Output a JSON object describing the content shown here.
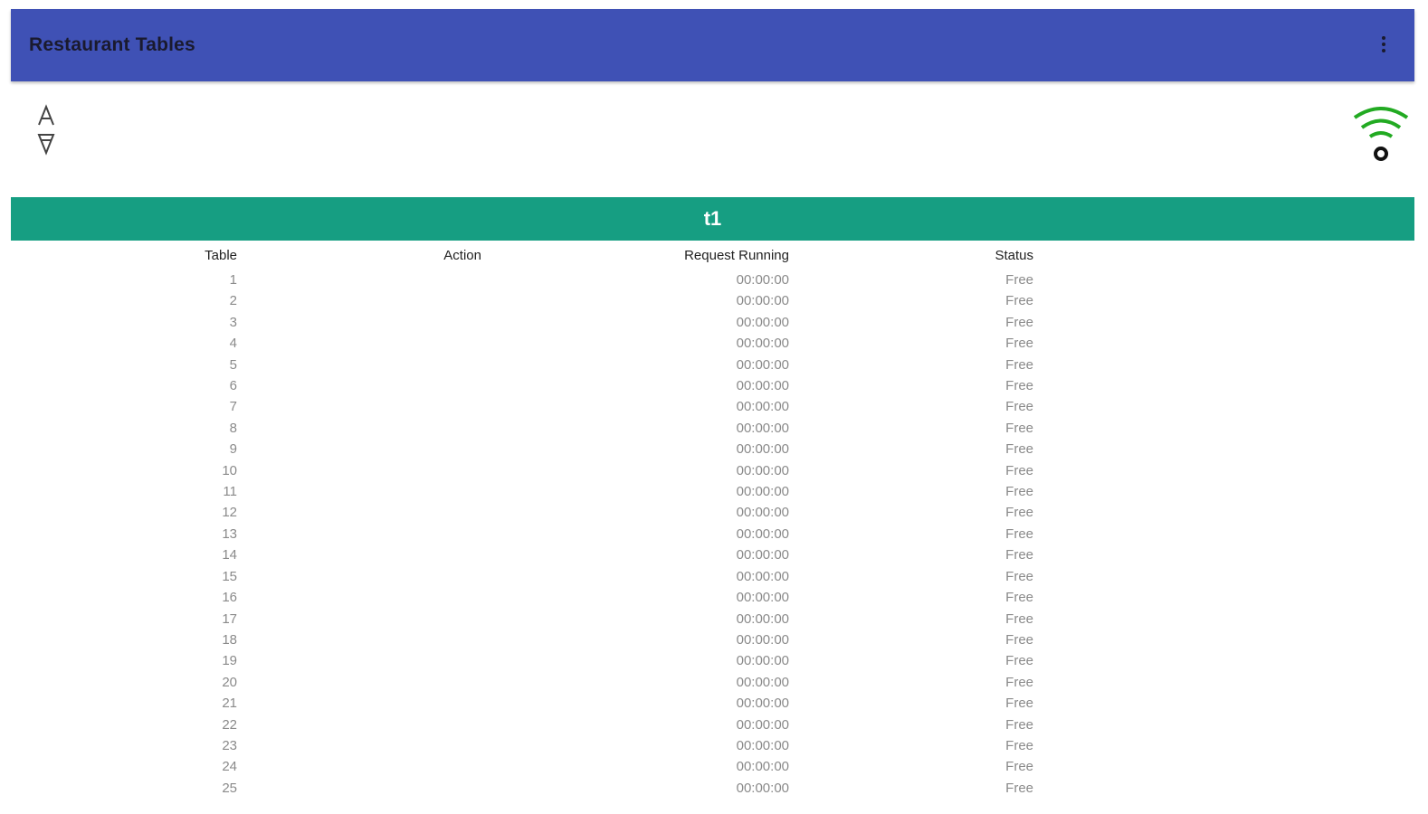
{
  "app_bar": {
    "title": "Restaurant Tables",
    "bg_color": "#3f51b5",
    "menu_icon": "more-vert-icon"
  },
  "toolbar": {
    "sort_icon": "sort-ascending-descending-icon",
    "connection_icon": "wifi-connected-icon",
    "connection_color": "#22aa22"
  },
  "section": {
    "title": "t1",
    "bg_color": "#169e82"
  },
  "table": {
    "headers": {
      "table": "Table",
      "action": "Action",
      "request": "Request Running",
      "status": "Status"
    },
    "rows": [
      {
        "table": "1",
        "action": "",
        "request": "00:00:00",
        "status": "Free"
      },
      {
        "table": "2",
        "action": "",
        "request": "00:00:00",
        "status": "Free"
      },
      {
        "table": "3",
        "action": "",
        "request": "00:00:00",
        "status": "Free"
      },
      {
        "table": "4",
        "action": "",
        "request": "00:00:00",
        "status": "Free"
      },
      {
        "table": "5",
        "action": "",
        "request": "00:00:00",
        "status": "Free"
      },
      {
        "table": "6",
        "action": "",
        "request": "00:00:00",
        "status": "Free"
      },
      {
        "table": "7",
        "action": "",
        "request": "00:00:00",
        "status": "Free"
      },
      {
        "table": "8",
        "action": "",
        "request": "00:00:00",
        "status": "Free"
      },
      {
        "table": "9",
        "action": "",
        "request": "00:00:00",
        "status": "Free"
      },
      {
        "table": "10",
        "action": "",
        "request": "00:00:00",
        "status": "Free"
      },
      {
        "table": "11",
        "action": "",
        "request": "00:00:00",
        "status": "Free"
      },
      {
        "table": "12",
        "action": "",
        "request": "00:00:00",
        "status": "Free"
      },
      {
        "table": "13",
        "action": "",
        "request": "00:00:00",
        "status": "Free"
      },
      {
        "table": "14",
        "action": "",
        "request": "00:00:00",
        "status": "Free"
      },
      {
        "table": "15",
        "action": "",
        "request": "00:00:00",
        "status": "Free"
      },
      {
        "table": "16",
        "action": "",
        "request": "00:00:00",
        "status": "Free"
      },
      {
        "table": "17",
        "action": "",
        "request": "00:00:00",
        "status": "Free"
      },
      {
        "table": "18",
        "action": "",
        "request": "00:00:00",
        "status": "Free"
      },
      {
        "table": "19",
        "action": "",
        "request": "00:00:00",
        "status": "Free"
      },
      {
        "table": "20",
        "action": "",
        "request": "00:00:00",
        "status": "Free"
      },
      {
        "table": "21",
        "action": "",
        "request": "00:00:00",
        "status": "Free"
      },
      {
        "table": "22",
        "action": "",
        "request": "00:00:00",
        "status": "Free"
      },
      {
        "table": "23",
        "action": "",
        "request": "00:00:00",
        "status": "Free"
      },
      {
        "table": "24",
        "action": "",
        "request": "00:00:00",
        "status": "Free"
      },
      {
        "table": "25",
        "action": "",
        "request": "00:00:00",
        "status": "Free"
      }
    ]
  }
}
